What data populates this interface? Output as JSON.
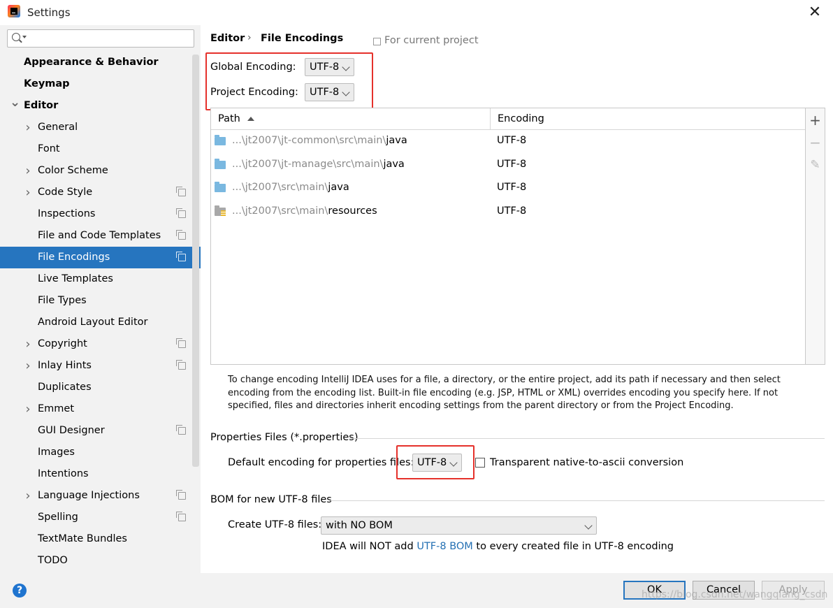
{
  "window": {
    "title": "Settings"
  },
  "sidebar": {
    "search_placeholder": "",
    "items": [
      {
        "label": "Appearance & Behavior",
        "level": 0,
        "bold": true,
        "arrow": ""
      },
      {
        "label": "Keymap",
        "level": 0,
        "bold": true,
        "arrow": ""
      },
      {
        "label": "Editor",
        "level": 0,
        "bold": true,
        "arrow": "down"
      },
      {
        "label": "General",
        "level": 1,
        "arrow": "right"
      },
      {
        "label": "Font",
        "level": 1,
        "arrow": ""
      },
      {
        "label": "Color Scheme",
        "level": 1,
        "arrow": "right"
      },
      {
        "label": "Code Style",
        "level": 1,
        "arrow": "right",
        "project": true
      },
      {
        "label": "Inspections",
        "level": 1,
        "arrow": "",
        "project": true
      },
      {
        "label": "File and Code Templates",
        "level": 1,
        "arrow": "",
        "project": true
      },
      {
        "label": "File Encodings",
        "level": 1,
        "arrow": "",
        "project": true,
        "selected": true
      },
      {
        "label": "Live Templates",
        "level": 1,
        "arrow": ""
      },
      {
        "label": "File Types",
        "level": 1,
        "arrow": ""
      },
      {
        "label": "Android Layout Editor",
        "level": 1,
        "arrow": ""
      },
      {
        "label": "Copyright",
        "level": 1,
        "arrow": "right",
        "project": true
      },
      {
        "label": "Inlay Hints",
        "level": 1,
        "arrow": "right",
        "project": true
      },
      {
        "label": "Duplicates",
        "level": 1,
        "arrow": ""
      },
      {
        "label": "Emmet",
        "level": 1,
        "arrow": "right"
      },
      {
        "label": "GUI Designer",
        "level": 1,
        "arrow": "",
        "project": true
      },
      {
        "label": "Images",
        "level": 1,
        "arrow": ""
      },
      {
        "label": "Intentions",
        "level": 1,
        "arrow": ""
      },
      {
        "label": "Language Injections",
        "level": 1,
        "arrow": "right",
        "project": true
      },
      {
        "label": "Spelling",
        "level": 1,
        "arrow": "",
        "project": true
      },
      {
        "label": "TextMate Bundles",
        "level": 1,
        "arrow": ""
      },
      {
        "label": "TODO",
        "level": 1,
        "arrow": ""
      }
    ]
  },
  "header": {
    "breadcrumb_parent": "Editor",
    "breadcrumb_separator": "›",
    "breadcrumb_current": "File Encodings",
    "scope_label": "For current project"
  },
  "encoding": {
    "global_label": "Global Encoding:",
    "global_value": "UTF-8",
    "project_label": "Project Encoding:",
    "project_value": "UTF-8"
  },
  "table": {
    "col_path": "Path",
    "col_encoding": "Encoding",
    "rows": [
      {
        "prefix": "...\\jt2007\\jt-common\\src\\main\\",
        "leaf": "java",
        "encoding": "UTF-8",
        "icon": "folder-icon"
      },
      {
        "prefix": "...\\jt2007\\jt-manage\\src\\main\\",
        "leaf": "java",
        "encoding": "UTF-8",
        "icon": "folder-icon"
      },
      {
        "prefix": "...\\jt2007\\src\\main\\",
        "leaf": "java",
        "encoding": "UTF-8",
        "icon": "folder-icon"
      },
      {
        "prefix": "...\\jt2007\\src\\main\\",
        "leaf": "resources",
        "encoding": "UTF-8",
        "icon": "resources-folder-icon"
      }
    ]
  },
  "toolbar": {
    "add": "+",
    "remove": "−",
    "edit": "✎"
  },
  "info_text": "To change encoding IntelliJ IDEA uses for a file, a directory, or the entire project, add its path if necessary and then select encoding from the encoding list. Built-in file encoding (e.g. JSP, HTML or XML) overrides encoding you specify here. If not specified, files and directories inherit encoding settings from the parent directory or from the Project Encoding.",
  "properties": {
    "section_title": "Properties Files (*.properties)",
    "default_label": "Default encoding for properties files:",
    "default_value": "UTF-8",
    "native_label": "Transparent native-to-ascii conversion"
  },
  "bom": {
    "section_title": "BOM for new UTF-8 files",
    "create_label": "Create UTF-8 files:",
    "create_value": "with NO BOM",
    "note_before": "IDEA will NOT add ",
    "note_link": "UTF-8 BOM",
    "note_after": " to every created file in UTF-8 encoding"
  },
  "footer": {
    "help": "?",
    "ok": "OK",
    "cancel": "Cancel",
    "apply": "Apply",
    "watermark": "https://blog.csdn.net/wangqiang_csdn"
  },
  "colors": {
    "selection": "#2675bf",
    "highlight_box": "#e5312b",
    "link": "#2470b3"
  }
}
